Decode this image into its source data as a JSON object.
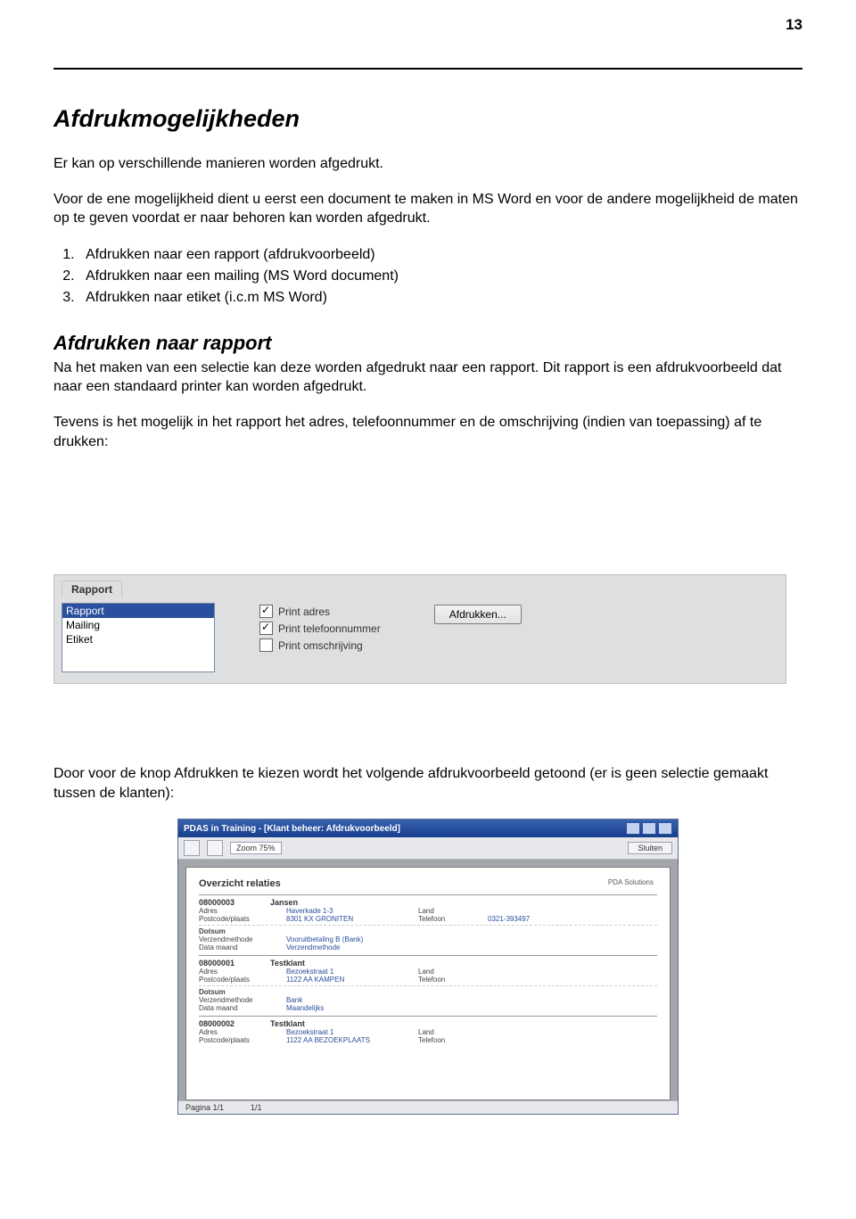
{
  "pageNumber": "13",
  "h1": "Afdrukmogelijkheden",
  "intro1": "Er kan op verschillende manieren worden afgedrukt.",
  "intro2": "Voor de ene mogelijkheid dient u eerst een document te maken in MS Word en voor de andere mogelijkheid de maten op te geven voordat er naar behoren kan worden afgedrukt.",
  "listItems": [
    "Afdrukken naar een rapport (afdrukvoorbeeld)",
    "Afdrukken naar een mailing (MS Word document)",
    "Afdrukken naar etiket (i.c.m MS Word)"
  ],
  "h2": "Afdrukken naar rapport",
  "para2a": "Na het maken van een selectie kan deze  worden afgedrukt naar een rapport. Dit rapport is een afdrukvoorbeeld dat naar een standaard printer kan worden afgedrukt.",
  "para2b": "Tevens is het mogelijk in het rapport het adres, telefoonnummer en de omschrijving (indien van toepassing) af te drukken:",
  "panel1": {
    "tab": "Rapport",
    "list": {
      "selected": "Rapport",
      "items": [
        "Mailing",
        "Etiket"
      ]
    },
    "checks": [
      {
        "label": "Print adres",
        "checked": true
      },
      {
        "label": "Print telefoonnummer",
        "checked": true
      },
      {
        "label": "Print omschrijving",
        "checked": false
      }
    ],
    "button": "Afdrukken..."
  },
  "para3": "Door voor de knop Afdrukken te kiezen wordt het volgende afdrukvoorbeeld getoond (er is geen selectie gemaakt tussen de klanten):",
  "panel2": {
    "title": "PDAS in Training - [Klant beheer: Afdrukvoorbeeld]",
    "toolbar": {
      "zoom": "Zoom 75%",
      "close": "Sluiten"
    },
    "pageRight": "PDA Solutions",
    "reportTitle": "Overzicht relaties",
    "records": [
      {
        "id": "08000003",
        "name": "Jansen",
        "rows": [
          {
            "c1": "Adres",
            "c2": "Haverkade 1-3",
            "c3": "Land",
            "c4": ""
          },
          {
            "c1": "Postcode/plaats",
            "c2": "8301 KX GRONITEN",
            "c3": "Telefoon",
            "c4": "0321-393497"
          }
        ],
        "sub": {
          "head": "Dotsum",
          "lines": [
            {
              "a": "Verzendmethode",
              "b": "Vooruitbetaling B (Bank)"
            },
            {
              "a": "Data maand",
              "b": "Verzendmethode"
            }
          ]
        }
      },
      {
        "id": "08000001",
        "name": "Testklant",
        "rows": [
          {
            "c1": "Adres",
            "c2": "Bezoekstraat 1",
            "c3": "Land",
            "c4": ""
          },
          {
            "c1": "Postcode/plaats",
            "c2": "1122 AA KAMPEN",
            "c3": "Telefoon",
            "c4": ""
          }
        ],
        "sub": {
          "head": "Dotsum",
          "lines": [
            {
              "a": "Verzendmethode",
              "b": "Bank"
            },
            {
              "a": "Data maand",
              "b": "Maandelijks"
            }
          ]
        }
      },
      {
        "id": "08000002",
        "name": "Testklant",
        "rows": [
          {
            "c1": "Adres",
            "c2": "Bezoekstraat 1",
            "c3": "Land",
            "c4": ""
          },
          {
            "c1": "Postcode/plaats",
            "c2": "1122 AA BEZOEKPLAATS",
            "c3": "Telefoon",
            "c4": ""
          }
        ]
      }
    ],
    "status": {
      "left": "Pagina 1/1",
      "right": "1/1"
    }
  }
}
